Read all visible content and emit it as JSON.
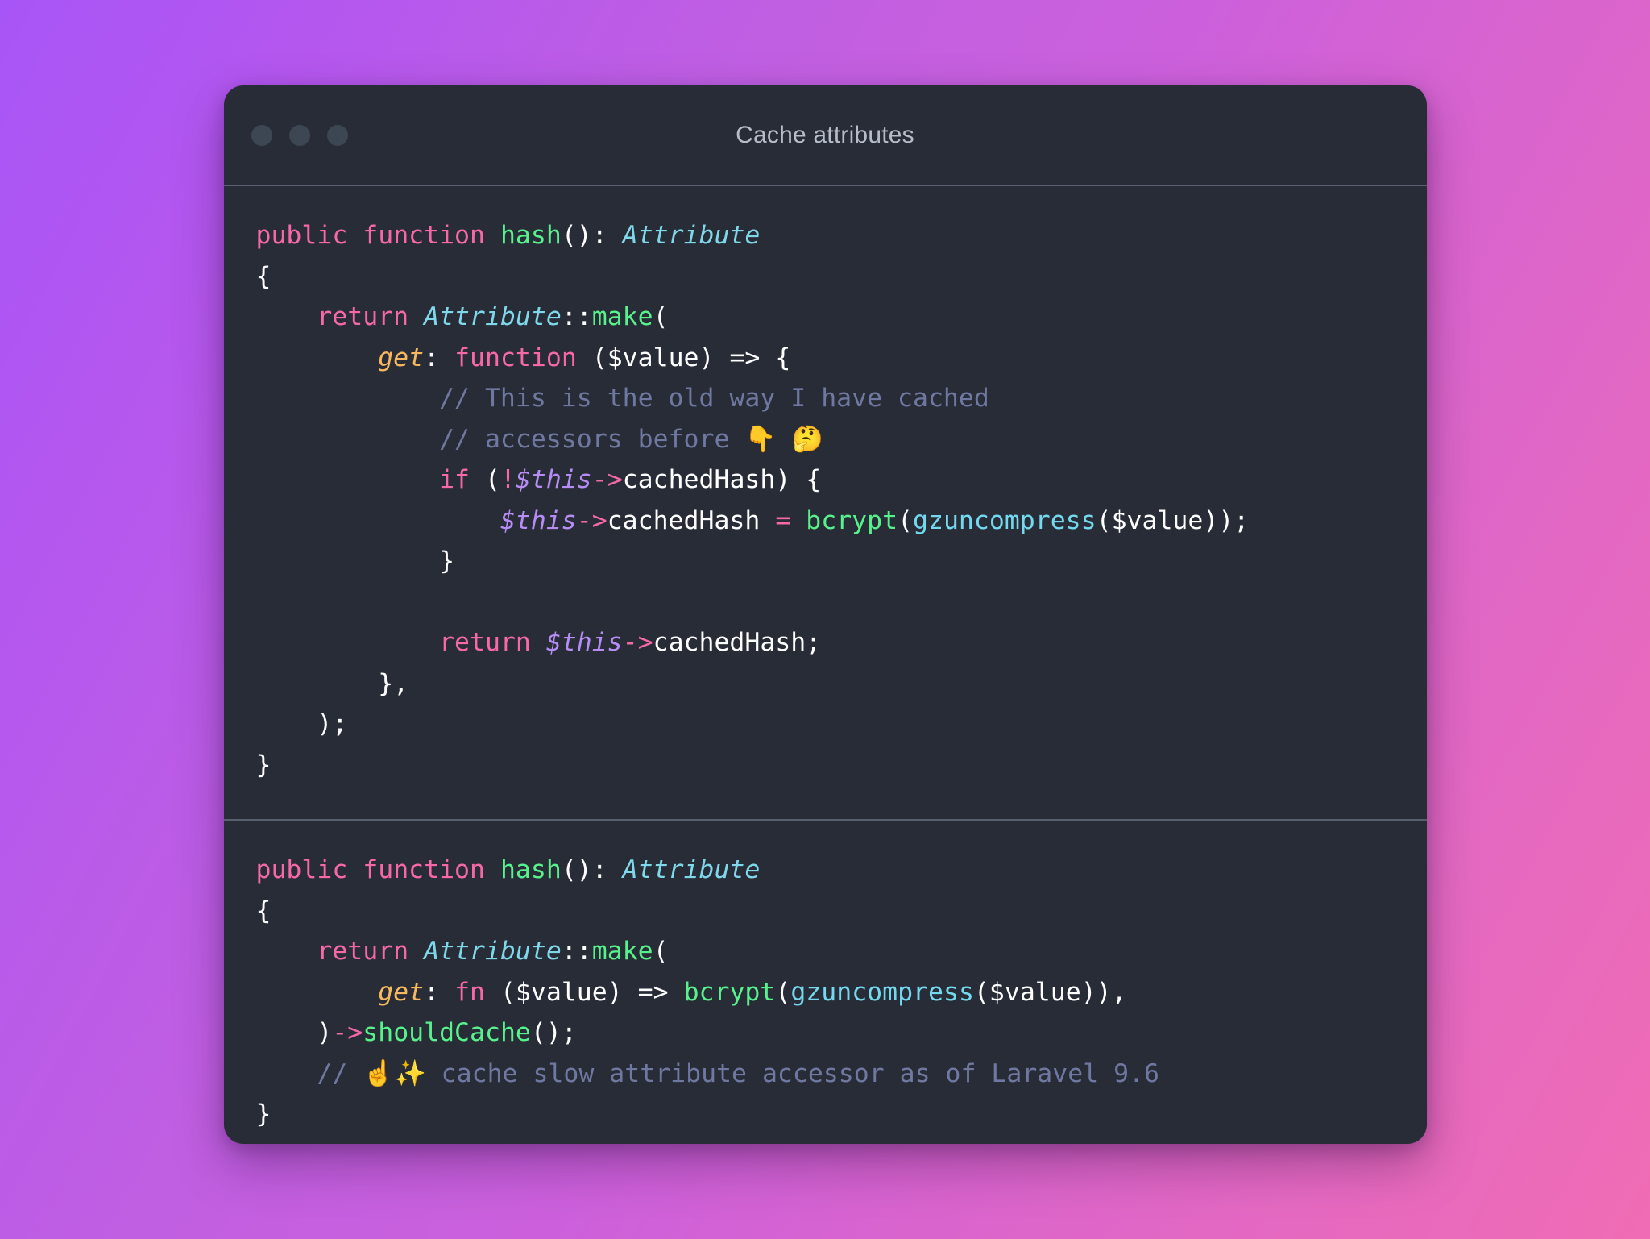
{
  "window": {
    "title": "Cache attributes",
    "background_color": "#282c37",
    "divider_color": "#585f70",
    "traffic_lights": [
      {
        "name": "close",
        "color": "#3d4754"
      },
      {
        "name": "minimize",
        "color": "#3d4754"
      },
      {
        "name": "maximize",
        "color": "#3d4754"
      }
    ]
  },
  "backdrop": {
    "gradient_from": "#a855f7",
    "gradient_mid": "#cc60dc",
    "gradient_to": "#f06cb4"
  },
  "theme": {
    "keyword": "#f768a8",
    "function": "#58f28c",
    "type": "#7fd8ea",
    "variable": "#b78df5",
    "builtin": "#74d8ee",
    "param": "#f7b860",
    "comment": "#6f78a0",
    "text": "#ffffff"
  },
  "panes": [
    {
      "id": "pane-top",
      "language": "php",
      "lines": [
        "public function hash(): Attribute",
        "{",
        "    return Attribute::make(",
        "        get: function ($value) => {",
        "            // This is the old way I have cached",
        "            // accessors before 👇 🤔",
        "            if (!$this->cachedHash) {",
        "                $this->cachedHash = bcrypt(gzuncompress($value));",
        "            }",
        "",
        "            return $this->cachedHash;",
        "        },",
        "    );",
        "}"
      ]
    },
    {
      "id": "pane-bottom",
      "language": "php",
      "lines": [
        "public function hash(): Attribute",
        "{",
        "    return Attribute::make(",
        "        get: fn ($value) => bcrypt(gzuncompress($value)),",
        "    )->shouldCache();",
        "    // ☝️✨ cache slow attribute accessor as of Laravel 9.6",
        "}"
      ]
    }
  ]
}
